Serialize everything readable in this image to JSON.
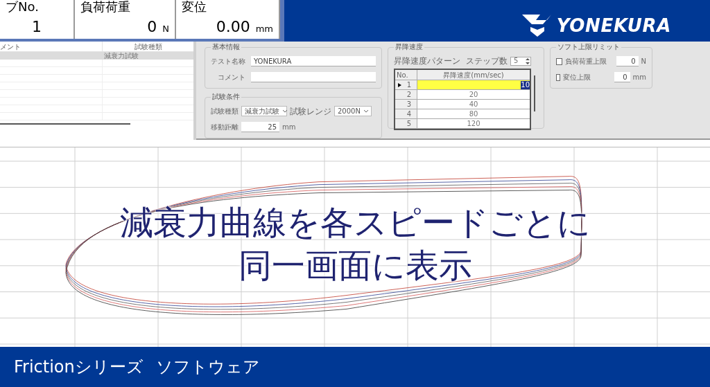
{
  "readouts": [
    {
      "label": "ブNo.",
      "value": "1"
    },
    {
      "label": "負荷荷重",
      "value": "0",
      "unit": "N"
    },
    {
      "label": "変位",
      "value": "0.00",
      "unit": "mm"
    }
  ],
  "logo": {
    "text": "YONEKURA"
  },
  "list": {
    "columns": [
      "メント",
      "試験種類"
    ],
    "rows": [
      {
        "test_type": "減衰力試験",
        "selected": true
      }
    ]
  },
  "basic_info": {
    "title": "基本情報",
    "fields": [
      {
        "label": "テスト名称",
        "value": "YONEKURA"
      },
      {
        "label": "コメント"
      }
    ]
  },
  "conditions": {
    "title": "試験条件",
    "test_type": {
      "label": "試験種類",
      "value": "減衰力試験"
    },
    "range": {
      "label": "試験レンジ",
      "value": "2000N"
    },
    "distance": {
      "label": "移動距離",
      "value": "25",
      "unit": "mm"
    }
  },
  "speed": {
    "title": "昇降速度",
    "pattern_label": "昇降速度パターン",
    "steps_label": "ステップ数",
    "steps": "5",
    "columns": [
      "No.",
      "昇降速度(mm/sec)"
    ],
    "rows": [
      {
        "no": "1",
        "speed": "10",
        "selected": true
      },
      {
        "no": "2",
        "speed": "20",
        "selected": false
      },
      {
        "no": "3",
        "speed": "40",
        "selected": false
      },
      {
        "no": "4",
        "speed": "80",
        "selected": false
      },
      {
        "no": "5",
        "speed": "120",
        "selected": false
      }
    ]
  },
  "limits": {
    "title": "ソフト上限リミット",
    "items": [
      {
        "label": "負荷荷重上限",
        "checked": false,
        "value": "0",
        "unit": "N"
      },
      {
        "label": "変位上限",
        "checked": false,
        "value": "0",
        "unit": "mm"
      }
    ]
  },
  "caption": {
    "lines": [
      "減衰力曲線を各スピードごとに",
      "同一画面に表示"
    ]
  },
  "footer": {
    "parts": [
      "Frictionシリーズ",
      "ソフトウェア"
    ]
  }
}
